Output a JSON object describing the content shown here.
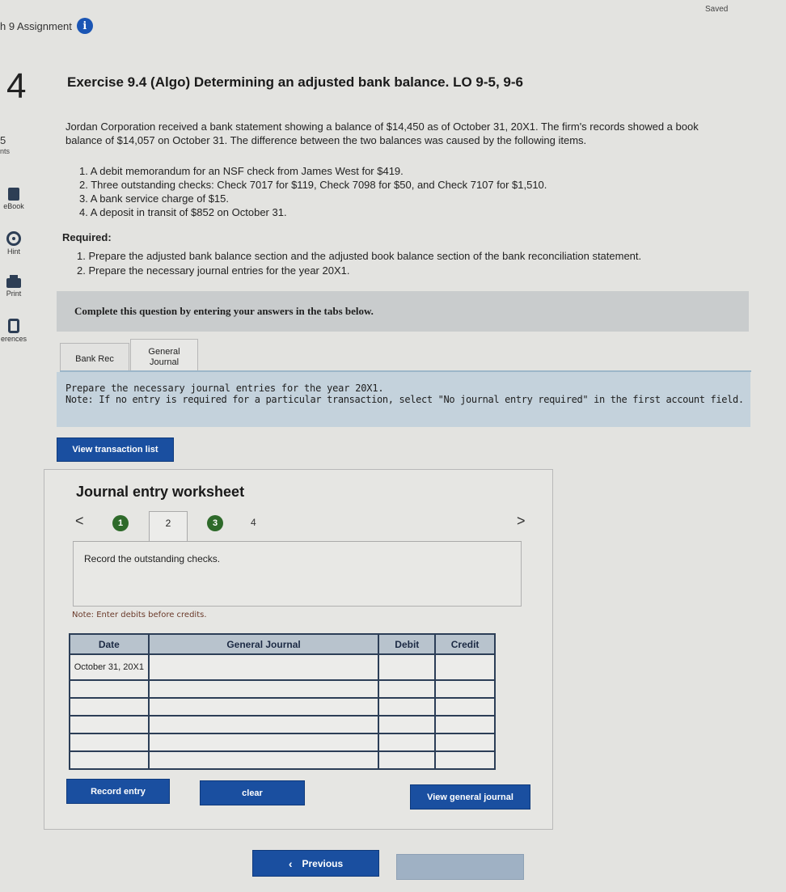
{
  "header": {
    "assignment_title": "h 9 Assignment",
    "info_icon_glyph": "i",
    "saved_status": "Saved"
  },
  "rail": {
    "question_number": "4",
    "points": "5",
    "points_label": "nts",
    "items": [
      {
        "label": "eBook",
        "icon": "ebook-icon"
      },
      {
        "label": "Hint",
        "icon": "hint-icon"
      },
      {
        "label": "Print",
        "icon": "print-icon"
      },
      {
        "label": "erences",
        "icon": "references-icon"
      }
    ]
  },
  "question": {
    "title": "Exercise 9.4 (Algo) Determining an adjusted bank balance. LO 9-5, 9-6",
    "intro": "Jordan Corporation received a bank statement showing a balance of $14,450 as of October 31, 20X1. The firm's records showed a book balance of $14,057 on October 31. The difference between the two balances was caused by the following items.",
    "items": [
      "1. A debit memorandum for an NSF check from James West for $419.",
      "2. Three outstanding checks: Check 7017 for $119, Check 7098 for $50, and Check 7107 for $1,510.",
      "3. A bank service charge of $15.",
      "4. A deposit in transit of $852 on October 31."
    ],
    "required_label": "Required:",
    "required": [
      "1. Prepare the adjusted bank balance section and the adjusted book balance section of the bank reconciliation statement.",
      "2. Prepare the necessary journal entries for the year 20X1."
    ]
  },
  "instructions": {
    "complete": "Complete this question by entering your answers in the tabs below."
  },
  "tabs": [
    {
      "label": "Bank Rec"
    },
    {
      "label_line1": "General",
      "label_line2": "Journal"
    }
  ],
  "tab_content": {
    "prepare": "Prepare the necessary journal entries for the year 20X1.",
    "note": "Note: If no entry is required for a particular transaction, select \"No journal entry required\" in the first account field."
  },
  "buttons": {
    "view_transactions": "View transaction list",
    "record_entry": "Record entry",
    "clear": "clear",
    "view_general_journal": "View general journal",
    "previous": "Previous",
    "next": ""
  },
  "worksheet": {
    "title": "Journal entry worksheet",
    "nav_prev": "<",
    "nav_next": ">",
    "steps": [
      "1",
      "2",
      "3",
      "4"
    ],
    "record_text": "Record the outstanding checks.",
    "debits_note": "Note: Enter debits before credits.",
    "columns": [
      "Date",
      "General Journal",
      "Debit",
      "Credit"
    ],
    "rows": [
      {
        "date": "October 31, 20X1",
        "account": "",
        "debit": "",
        "credit": ""
      },
      {
        "date": "",
        "account": "",
        "debit": "",
        "credit": ""
      },
      {
        "date": "",
        "account": "",
        "debit": "",
        "credit": ""
      },
      {
        "date": "",
        "account": "",
        "debit": "",
        "credit": ""
      },
      {
        "date": "",
        "account": "",
        "debit": "",
        "credit": ""
      },
      {
        "date": "",
        "account": "",
        "debit": "",
        "credit": ""
      }
    ]
  }
}
